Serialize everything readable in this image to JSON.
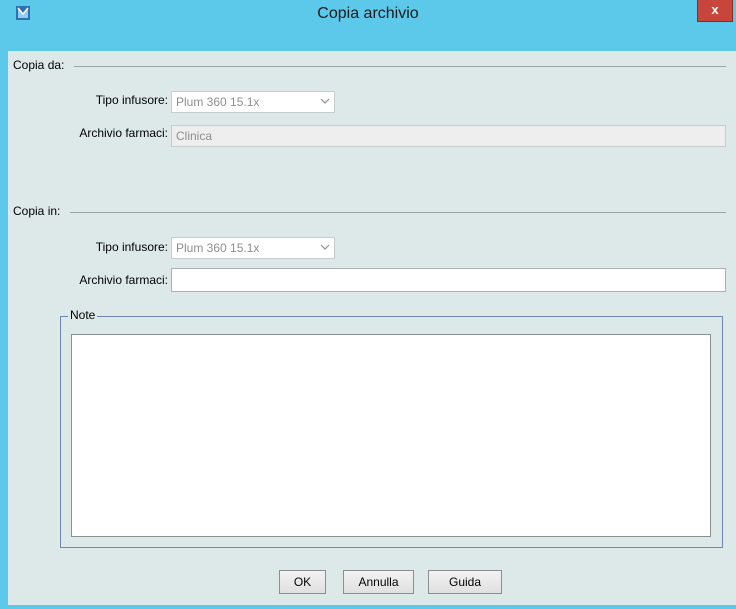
{
  "window": {
    "title": "Copia archivio",
    "close_label": "x",
    "accent": "#5cc8ea"
  },
  "copy_from": {
    "section_label": "Copia da:",
    "infuser_label": "Tipo infusore:",
    "infuser_value": "Plum 360 15.1x",
    "library_label": "Archivio farmaci:",
    "library_value": "Clinica"
  },
  "copy_to": {
    "section_label": "Copia in:",
    "infuser_label": "Tipo infusore:",
    "infuser_value": "Plum 360 15.1x",
    "library_label": "Archivio farmaci:",
    "library_value": ""
  },
  "notes": {
    "label": "Note",
    "value": ""
  },
  "buttons": {
    "ok": "OK",
    "cancel": "Annulla",
    "help": "Guida"
  }
}
